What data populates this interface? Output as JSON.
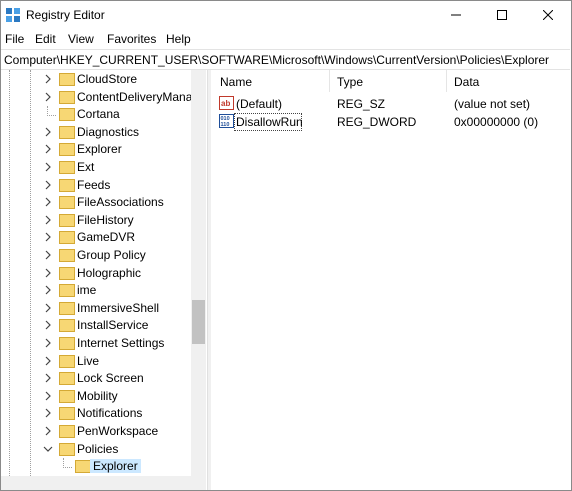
{
  "window": {
    "title": "Registry Editor"
  },
  "menu": {
    "items": [
      {
        "label": "File"
      },
      {
        "label": "Edit"
      },
      {
        "label": "View"
      },
      {
        "label": "Favorites"
      },
      {
        "label": "Help"
      }
    ]
  },
  "address": {
    "path": "Computer\\HKEY_CURRENT_USER\\SOFTWARE\\Microsoft\\Windows\\CurrentVersion\\Policies\\Explorer"
  },
  "tree": {
    "items": [
      {
        "label": "CloudStore",
        "expander": "collapsed"
      },
      {
        "label": "ContentDeliveryMana",
        "expander": "collapsed"
      },
      {
        "label": "Cortana",
        "expander": "none"
      },
      {
        "label": "Diagnostics",
        "expander": "collapsed"
      },
      {
        "label": "Explorer",
        "expander": "collapsed"
      },
      {
        "label": "Ext",
        "expander": "collapsed"
      },
      {
        "label": "Feeds",
        "expander": "collapsed"
      },
      {
        "label": "FileAssociations",
        "expander": "collapsed"
      },
      {
        "label": "FileHistory",
        "expander": "collapsed"
      },
      {
        "label": "GameDVR",
        "expander": "collapsed"
      },
      {
        "label": "Group Policy",
        "expander": "collapsed"
      },
      {
        "label": "Holographic",
        "expander": "collapsed"
      },
      {
        "label": "ime",
        "expander": "collapsed"
      },
      {
        "label": "ImmersiveShell",
        "expander": "collapsed"
      },
      {
        "label": "InstallService",
        "expander": "collapsed"
      },
      {
        "label": "Internet Settings",
        "expander": "collapsed"
      },
      {
        "label": "Live",
        "expander": "collapsed"
      },
      {
        "label": "Lock Screen",
        "expander": "collapsed"
      },
      {
        "label": "Mobility",
        "expander": "collapsed"
      },
      {
        "label": "Notifications",
        "expander": "collapsed"
      },
      {
        "label": "PenWorkspace",
        "expander": "collapsed"
      },
      {
        "label": "Policies",
        "expander": "expanded"
      },
      {
        "label": "Explorer",
        "expander": "none",
        "child": true,
        "selected": true
      }
    ]
  },
  "list": {
    "columns": {
      "name": "Name",
      "type": "Type",
      "data": "Data"
    },
    "rows": [
      {
        "name": "(Default)",
        "type": "REG_SZ",
        "data": "(value not set)",
        "icon": "ab"
      },
      {
        "name": "DisallowRun",
        "type": "REG_DWORD",
        "data": "0x00000000 (0)",
        "icon": "010\n110",
        "focused": true
      }
    ]
  },
  "colors": {
    "folder": "#f7d774",
    "selected_bg": "#cce8ff",
    "string_icon": "#c0392b",
    "dword_icon": "#1f4e99"
  }
}
